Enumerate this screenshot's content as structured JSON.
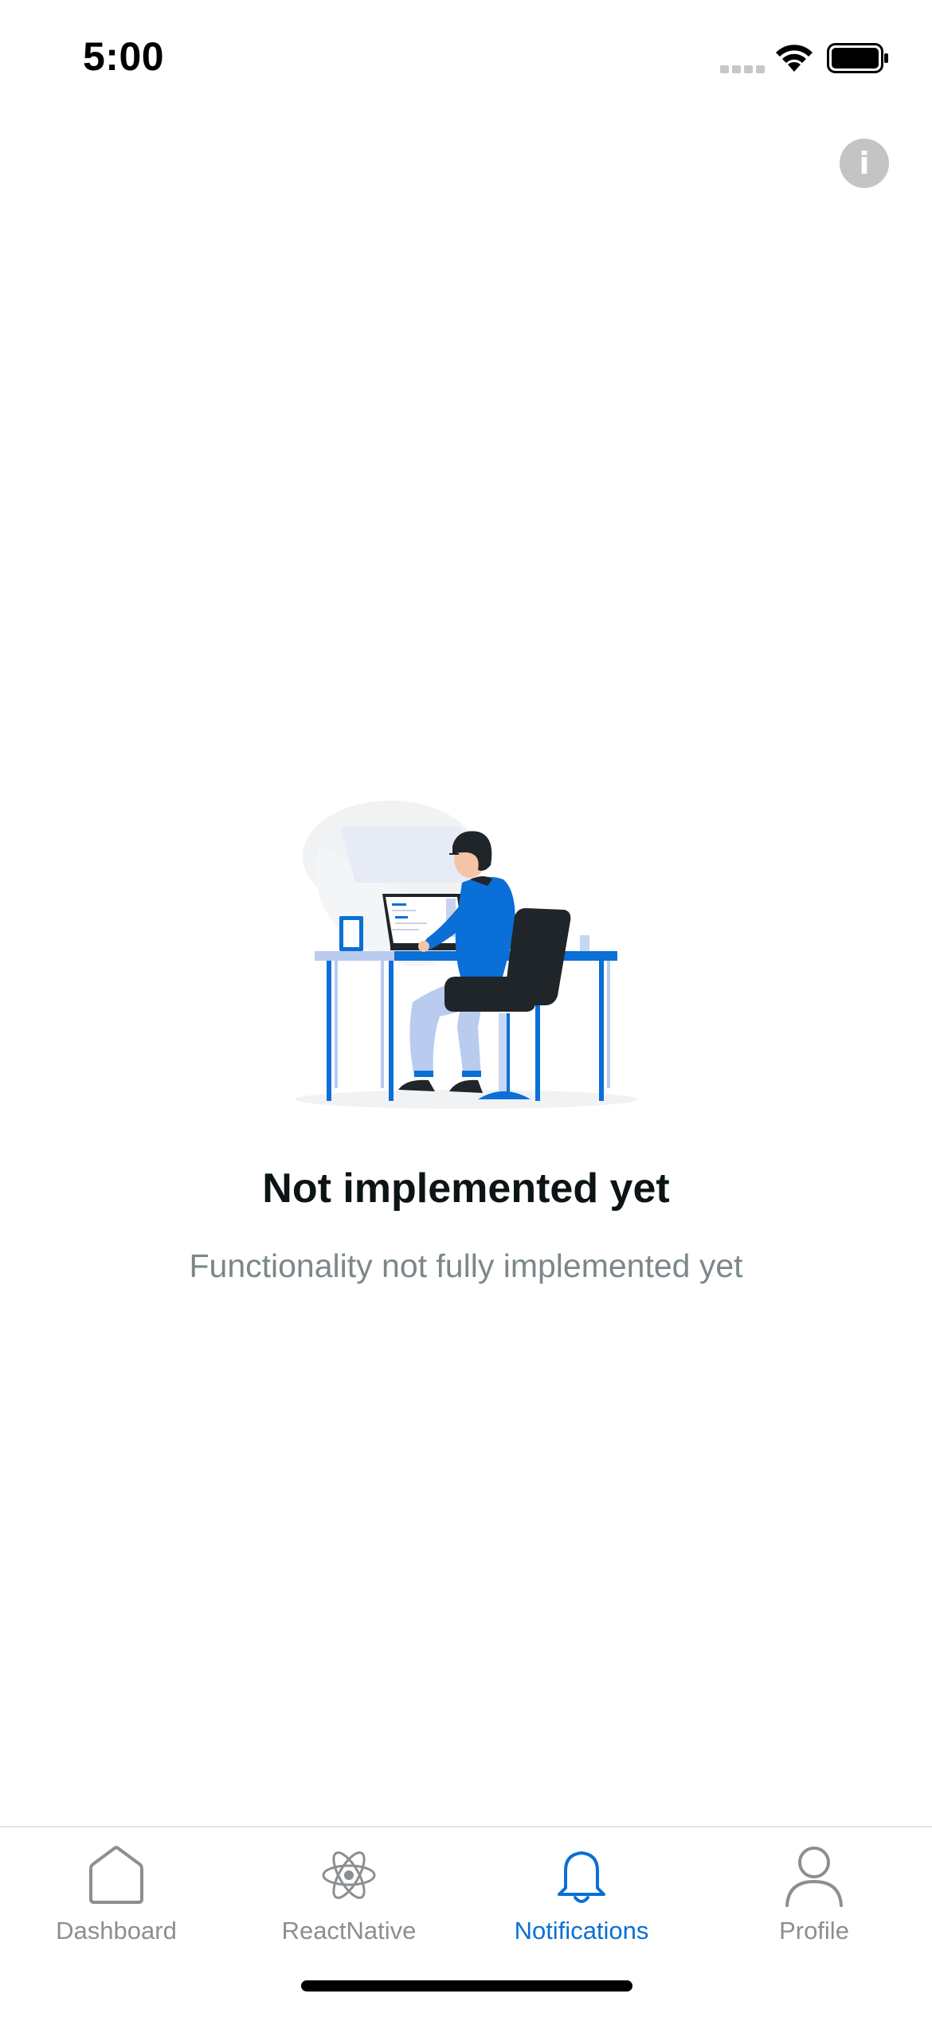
{
  "status_bar": {
    "time": "5:00",
    "icons": [
      "signal-icon",
      "wifi-icon",
      "battery-icon"
    ]
  },
  "header": {
    "info_button": {
      "icon": "info-icon",
      "glyph": "i"
    }
  },
  "empty_state": {
    "illustration": "person-at-desk-illustration",
    "title": "Not implemented yet",
    "subtitle": "Functionality not fully implemented yet"
  },
  "tab_bar": {
    "active_color": "#0a6fd6",
    "inactive_color": "#8b8f92",
    "tabs": [
      {
        "label": "Dashboard",
        "icon": "home-icon",
        "active": false
      },
      {
        "label": "ReactNative",
        "icon": "react-atom-icon",
        "active": false
      },
      {
        "label": "Notifications",
        "icon": "bell-icon",
        "active": true
      },
      {
        "label": "Profile",
        "icon": "user-icon",
        "active": false
      }
    ]
  }
}
